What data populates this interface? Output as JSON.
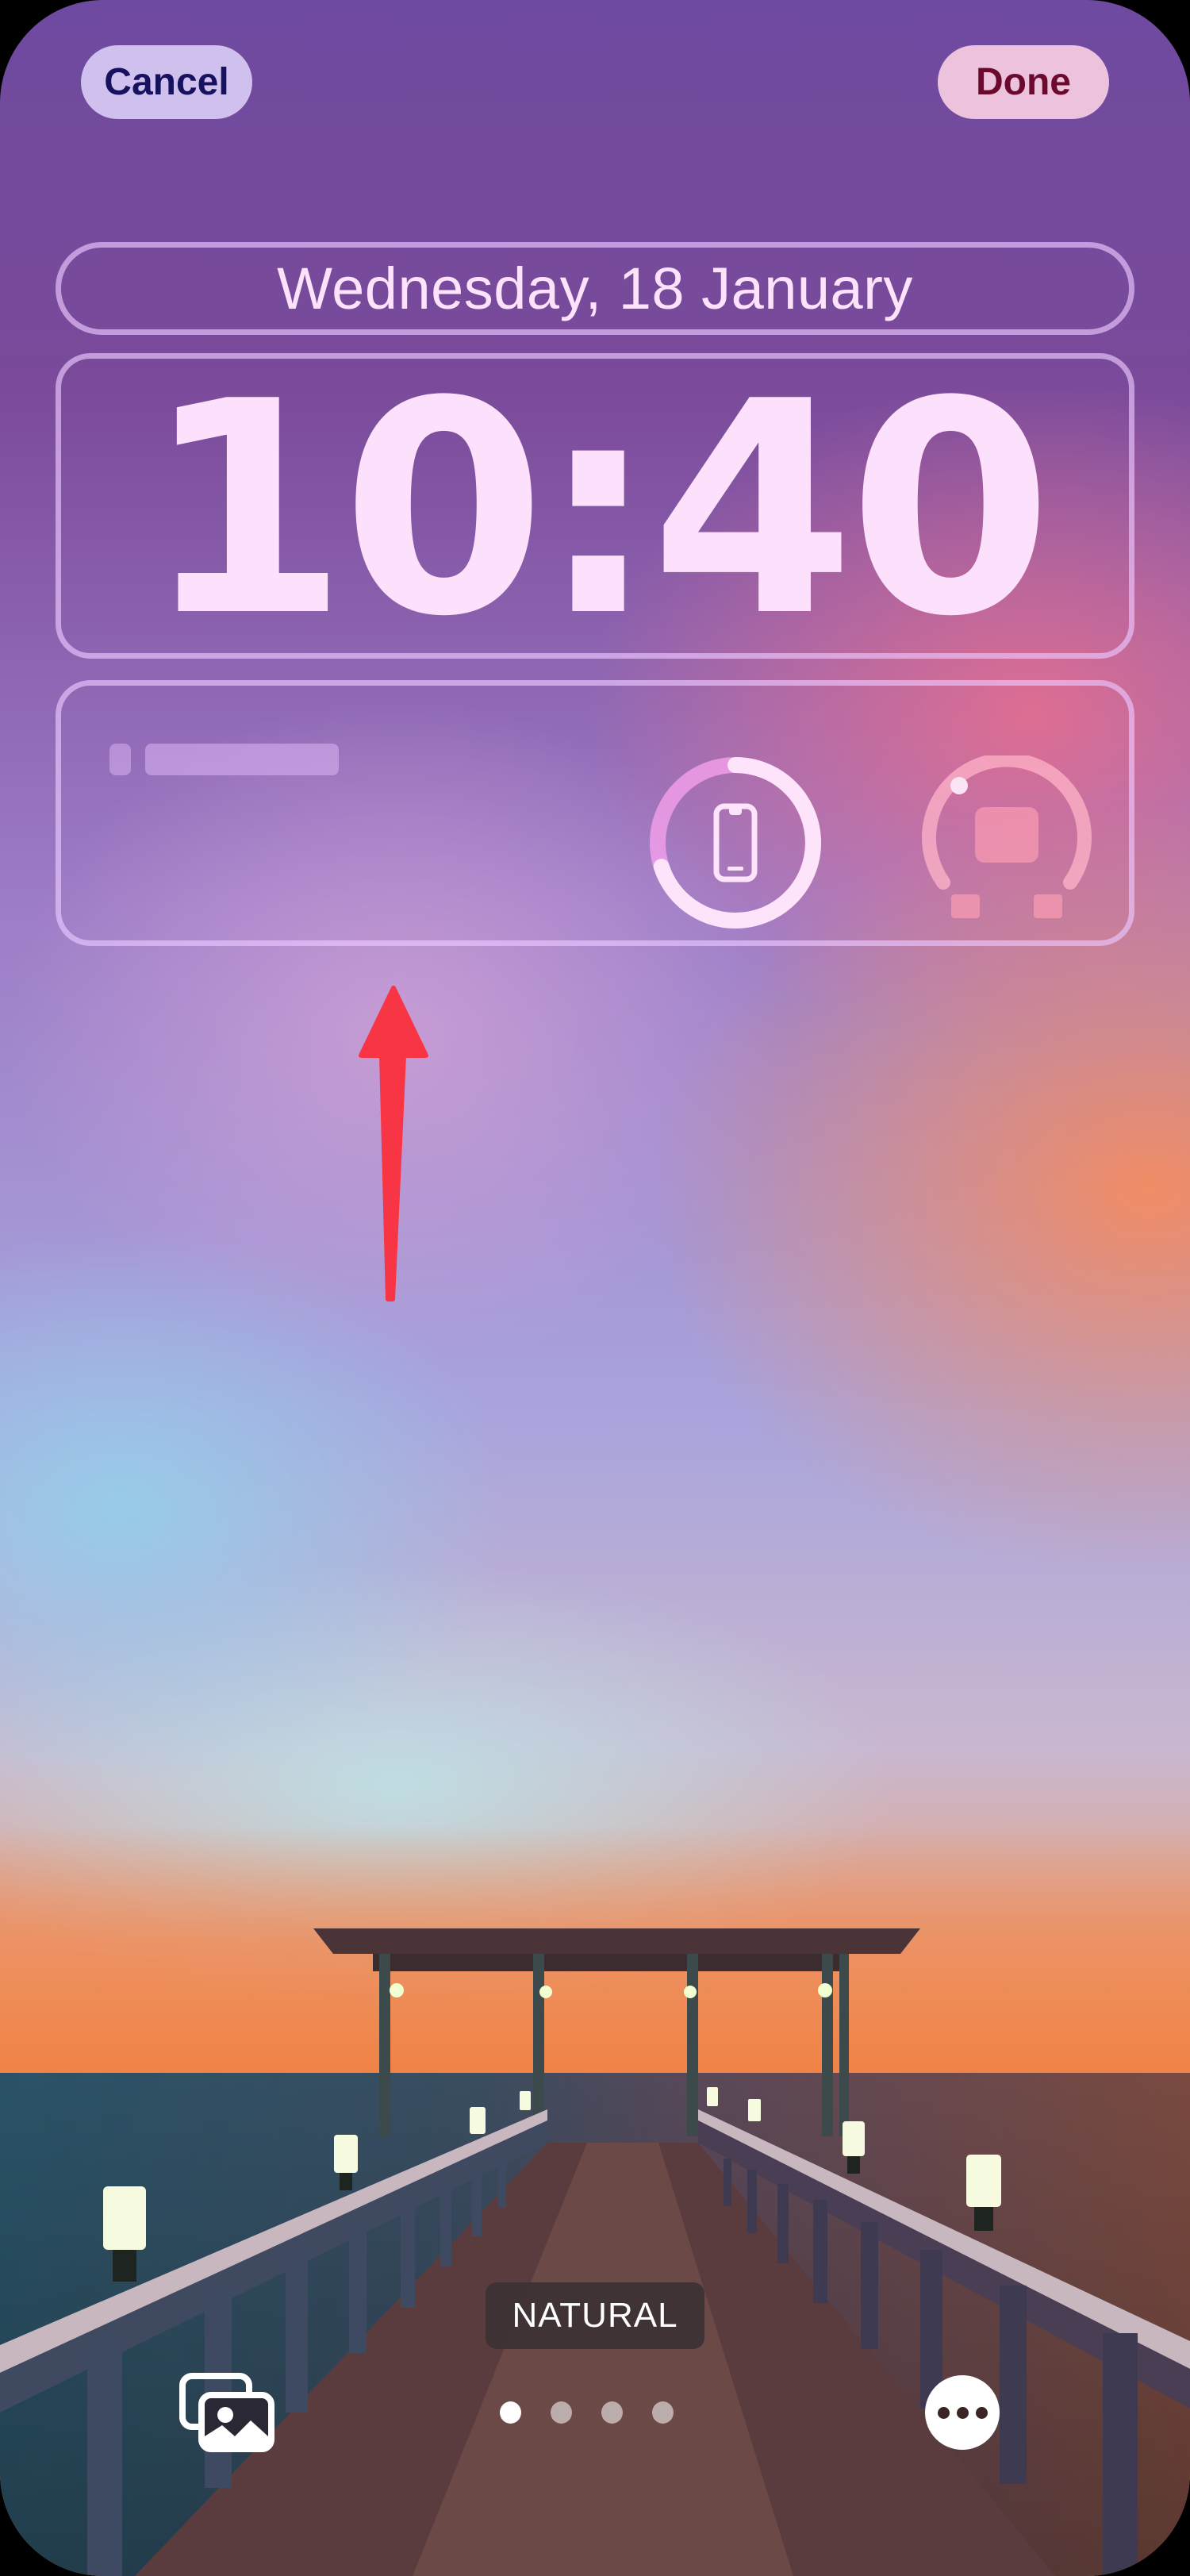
{
  "header": {
    "cancel_label": "Cancel",
    "done_label": "Done"
  },
  "lock_screen": {
    "date": "Wednesday, 18 January",
    "time": "10:40"
  },
  "widgets": {
    "battery_level_percent": 70,
    "battery_icon": "iphone-icon",
    "second_widget_icon": "device-gauge-icon"
  },
  "annotation": {
    "arrow_color": "#f73545",
    "arrow_direction": "up"
  },
  "wallpaper": {
    "filter_name": "NATURAL",
    "page_count": 4,
    "active_page": 1
  },
  "bottom_bar": {
    "photos_icon": "photo-gallery-icon",
    "more_icon": "more-ellipsis-icon"
  },
  "colors": {
    "cancel_text": "#17125e",
    "done_text": "#6b0a2c",
    "lock_text": "#fde0fb"
  }
}
